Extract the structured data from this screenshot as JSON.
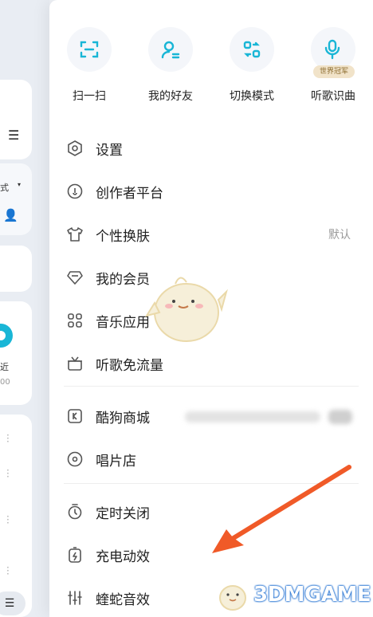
{
  "background": {
    "mode_label": "式",
    "recent_label": "近",
    "recent_count": "00"
  },
  "quick_actions": [
    {
      "label": "扫一扫",
      "icon": "scan-icon"
    },
    {
      "label": "我的好友",
      "icon": "friends-icon"
    },
    {
      "label": "切换模式",
      "icon": "switch-mode-icon"
    },
    {
      "label": "听歌识曲",
      "icon": "music-recognition-icon",
      "badge": "世界冠军"
    }
  ],
  "menu": {
    "settings": "设置",
    "creator": "创作者平台",
    "skin": "个性换肤",
    "skin_value": "默认",
    "vip": "我的会员",
    "apps": "音乐应用",
    "free_traffic": "听歌免流量",
    "shop": "酷狗商城",
    "record_store": "唱片店",
    "timer": "定时关闭",
    "charging": "充电动效",
    "equalizer": "蝰蛇音效"
  },
  "watermark": {
    "text": "3DMGAME"
  },
  "colors": {
    "accent": "#19b6d6",
    "arrow": "#f05a28",
    "badge_bg": "#f1e3c9"
  }
}
